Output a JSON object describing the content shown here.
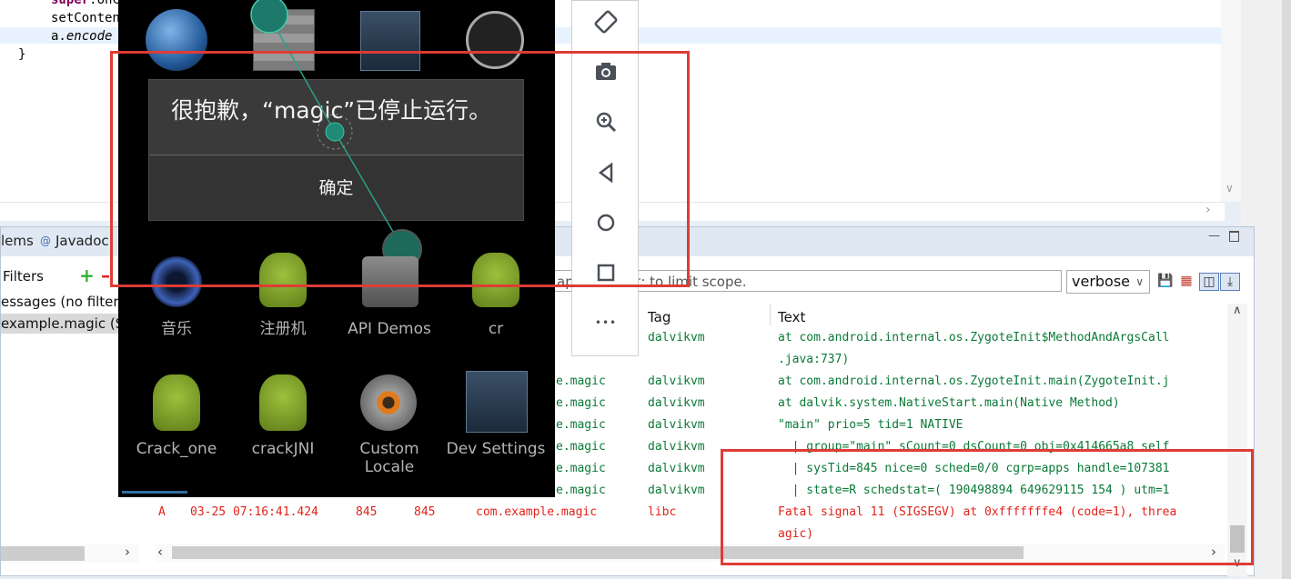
{
  "editor": {
    "lines": [
      {
        "a": "super",
        "b": ".onCr"
      },
      {
        "text": "setConten"
      },
      {
        "a": "a.",
        "b": "encode"
      },
      {
        "text": "}"
      }
    ]
  },
  "panel": {
    "tabs": [
      "lems",
      "Javadoc"
    ],
    "tab_at": "@",
    "filters_label": "Filters",
    "add_filter": "+",
    "remove_filter": "–",
    "filters": [
      "essages (no filters)",
      "example.magic (Se"
    ],
    "search_placeholder": "text: to limit scope.",
    "search_prefix": "ap",
    "level": "verbose",
    "columns": {
      "tag": "Tag",
      "text": "Text"
    },
    "rows": [
      {
        "pkg": "",
        "tag": "dalvikvm",
        "text": "at com.android.internal.os.ZygoteInit$MethodAndArgsCall"
      },
      {
        "pkg": "",
        "tag": "",
        "text": ".java:737)"
      },
      {
        "pkg": "e.magic",
        "tag": "dalvikvm",
        "text": "at com.android.internal.os.ZygoteInit.main(ZygoteInit.j"
      },
      {
        "pkg": "e.magic",
        "tag": "dalvikvm",
        "text": "at dalvik.system.NativeStart.main(Native Method)"
      },
      {
        "pkg": "e.magic",
        "tag": "dalvikvm",
        "text": "\"main\" prio=5 tid=1 NATIVE"
      },
      {
        "pkg": "e.magic",
        "tag": "dalvikvm",
        "text": "  | group=\"main\" sCount=0 dsCount=0 obj=0x414665a8 self"
      },
      {
        "pkg": "e.magic",
        "tag": "dalvikvm",
        "text": "  | sysTid=845 nice=0 sched=0/0 cgrp=apps handle=107381"
      },
      {
        "pkg": "e.magic",
        "tag": "dalvikvm",
        "text": "  | state=R schedstat=( 190498894 649629115 154 ) utm=1"
      }
    ],
    "error_row": {
      "level": "A",
      "time": "03-25 07:16:41.424",
      "pid": "845",
      "tid": "845",
      "app": "com.example.magic",
      "tag": "libc",
      "text": "Fatal signal 11 (SIGSEGV) at 0xfffffffe4 (code=1), threa",
      "text2": "agic)"
    }
  },
  "emulator": {
    "apps_row1": [
      "音乐",
      "注册机",
      "API Demos",
      "cr"
    ],
    "apps_row2": [
      "Crack_one",
      "crackJNI",
      "Custom Locale",
      "Dev Settings"
    ],
    "dialog_title": "很抱歉，“magic”已停止运行。",
    "dialog_ok": "确定"
  },
  "toolbar": {
    "icons": [
      "rotate-icon",
      "camera-icon",
      "zoom-icon",
      "back-icon",
      "home-icon",
      "overview-icon",
      "more-icon"
    ],
    "more_glyph": "•••"
  },
  "colors": {
    "highlight": "#de3c36",
    "log_green": "#0a7a36",
    "log_red": "#e2231a"
  }
}
